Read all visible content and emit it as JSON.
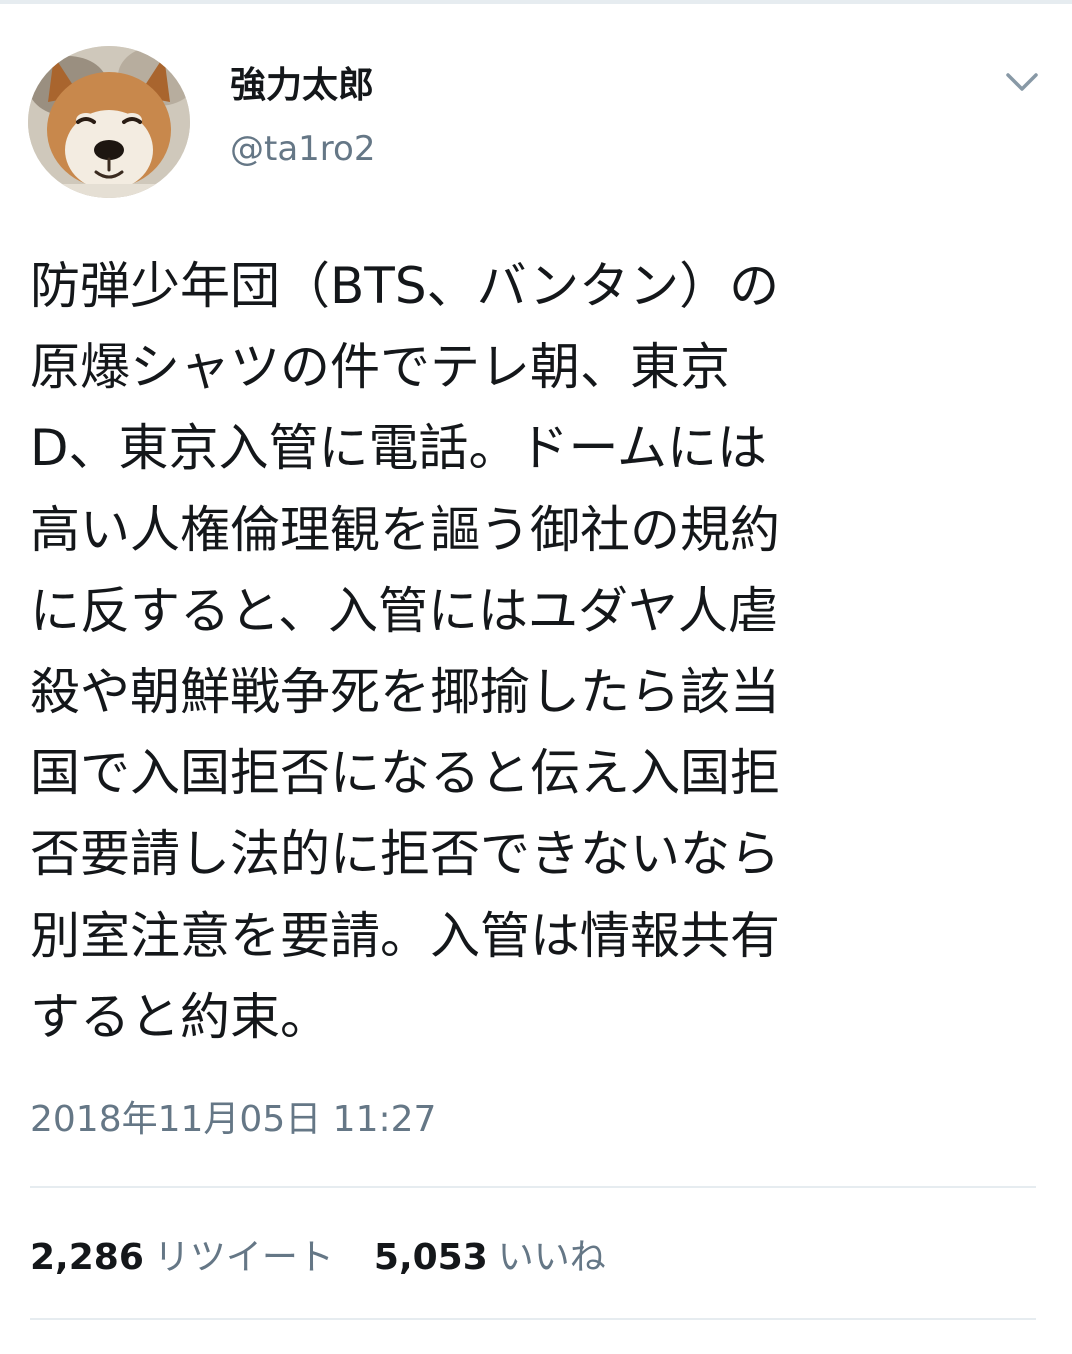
{
  "tweet": {
    "author": {
      "display_name": "強力太郎",
      "handle": "@ta1ro2",
      "avatar_icon": "shiba-dog-avatar"
    },
    "menu_icon": "chevron-down-icon",
    "text": "防弾少年団（BTS、バンタン）の\n原爆シャツの件でテレ朝、東京\nD、東京入管に電話。ドームには\n高い人権倫理観を謳う御社の規約\nに反すると、入管にはユダヤ人虐\n殺や朝鮮戦争死を揶揄したら該当\n国で入国拒否になると伝え入国拒\n否要請し法的に拒否できないなら\n別室注意を要請。入管は情報共有\nすると約束。",
    "timestamp": "2018年11月05日 11:27",
    "stats": {
      "retweets": {
        "count": "2,286",
        "label": "リツイート"
      },
      "likes": {
        "count": "5,053",
        "label": "いいね"
      }
    }
  },
  "colors": {
    "text_primary": "#14171a",
    "text_secondary": "#657786",
    "divider": "#e6ecf0",
    "background": "#ffffff"
  }
}
